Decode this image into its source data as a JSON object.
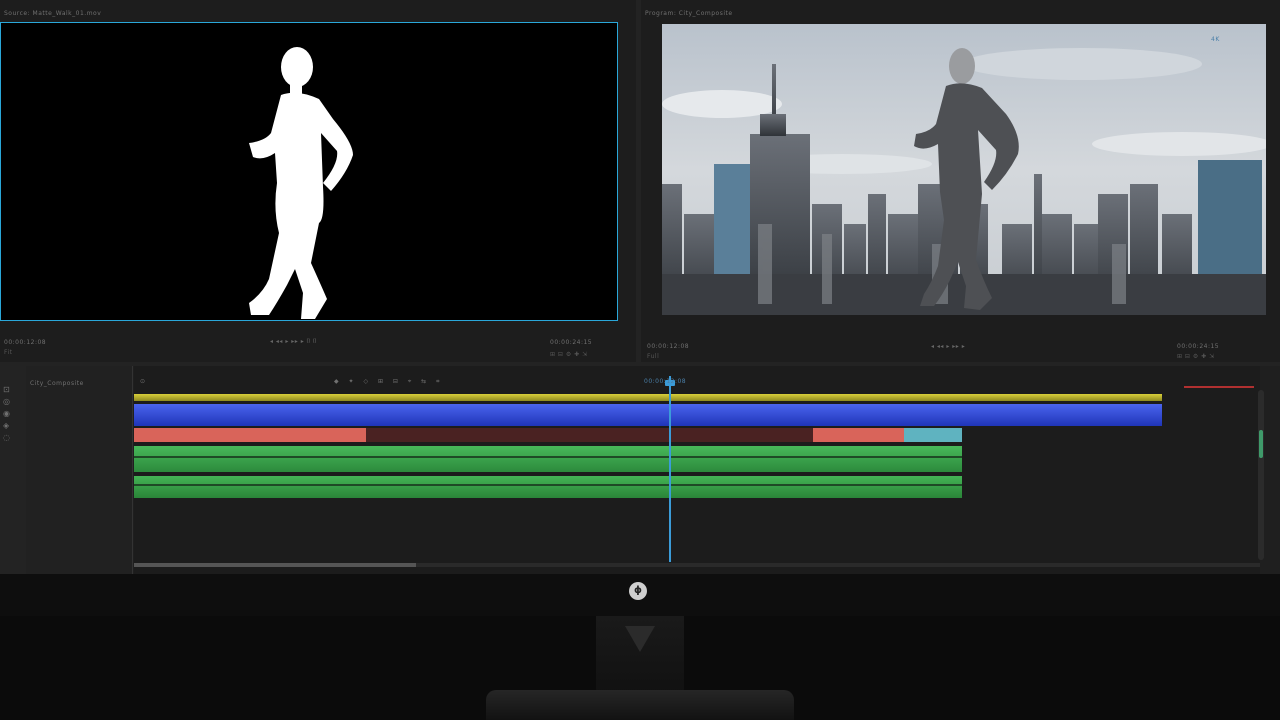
{
  "source_monitor": {
    "title": "Source: Matte_Walk_01.mov",
    "timecode_left": "00:00:12:08",
    "timecode_right": "00:00:24:15",
    "fit_label": "Fit",
    "frame_border_color": "#2aa7d9"
  },
  "program_monitor": {
    "title": "Program: City_Composite",
    "badge": "4K",
    "timecode_left": "00:00:12:08",
    "timecode_right": "00:00:24:15",
    "fit_label": "Full"
  },
  "timeline": {
    "sequence_label": "City_Composite",
    "playhead_timecode": "00:00:12:08",
    "track_icons": [
      "lock-icon",
      "target-icon",
      "eye-icon",
      "speaker-icon"
    ],
    "tools_glyphs": [
      "◆",
      "✦",
      "◇",
      "⊞",
      "⊟",
      "⌖",
      "⇆",
      "⌗"
    ],
    "playhead_color": "#3b9bd8",
    "clip_colors": {
      "yellow": "#c9c02a",
      "blue": "#2e47d6",
      "red": "#d9645a",
      "green": "#3aa84a"
    }
  },
  "monitor": {
    "logo_glyph": "ϕ"
  }
}
